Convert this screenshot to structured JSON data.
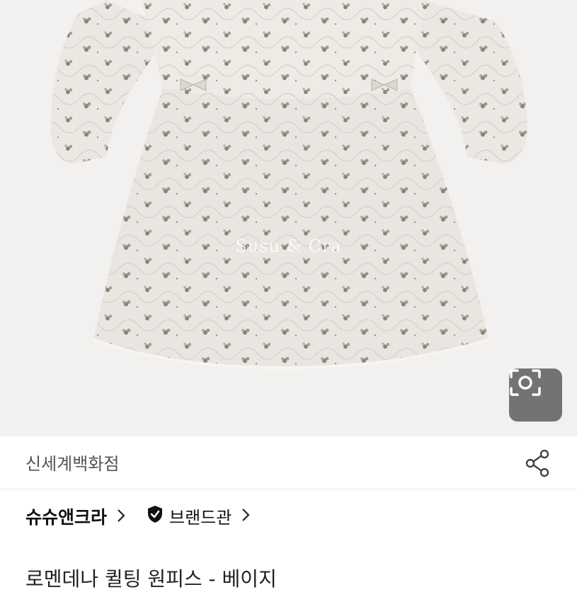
{
  "product": {
    "watermark": "Susu & Cra",
    "image_description_icon": "lens-search-icon",
    "title": "로멘데나 퀼팅 원피스 - 베이지"
  },
  "store": {
    "name": "신세계백화점",
    "share_icon": "share-icon"
  },
  "brand": {
    "name": "슈슈앤크라",
    "brandhall_label": "브랜드관",
    "verified_icon": "verified-shield-icon",
    "chevron_icon": "chevron-right-icon"
  },
  "colors": {
    "image_background": "#f2f1f0",
    "dress_fabric": "#e9e6e1",
    "floral_print": "#8a857c",
    "text_primary": "#111111",
    "text_secondary": "#555555"
  }
}
